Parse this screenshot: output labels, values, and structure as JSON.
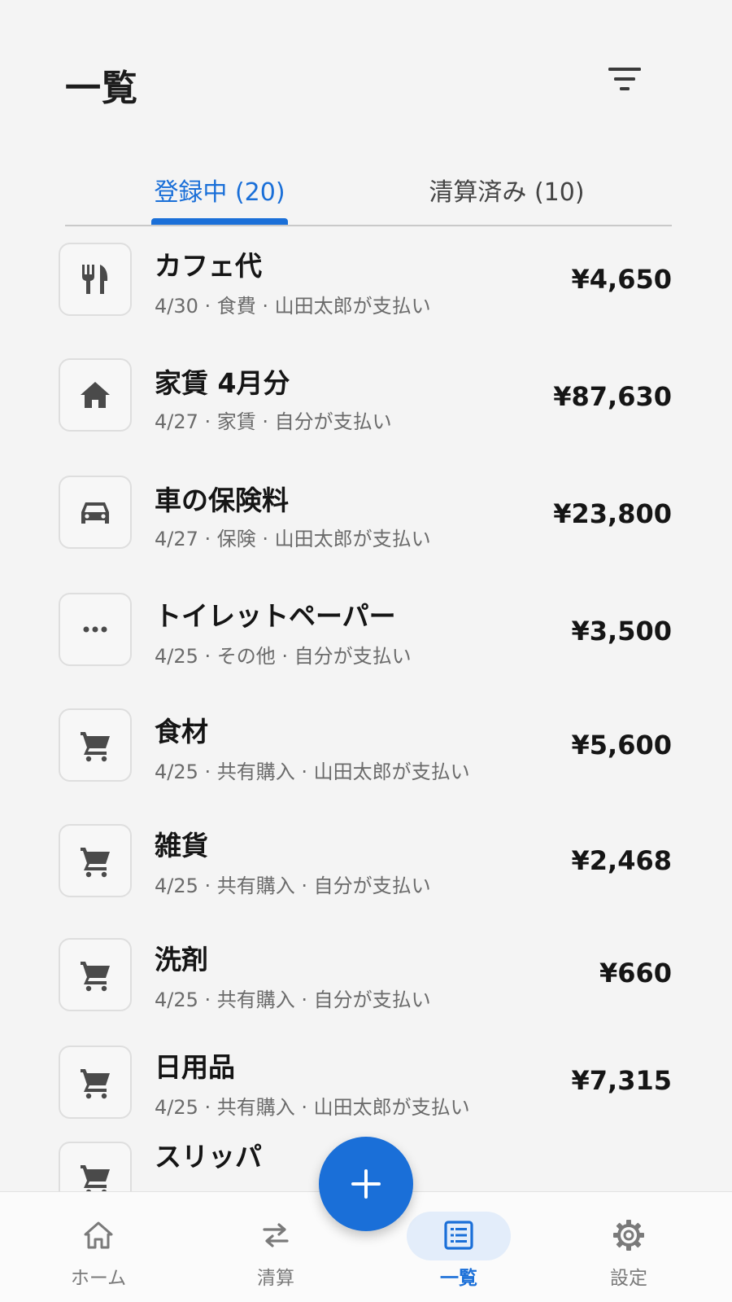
{
  "header": {
    "title": "一覧",
    "filter_icon": "filter-icon"
  },
  "tabs": [
    {
      "label": "登録中 (20)",
      "active": true
    },
    {
      "label": "清算済み (10)",
      "active": false
    }
  ],
  "expenses": [
    {
      "title": "カフェ代",
      "sub": "4/30 · 食費 · 山田太郎が支払い",
      "amount": "¥4,650",
      "icon": "cutlery-icon"
    },
    {
      "title": "家賃 4月分",
      "sub": "4/27 · 家賃 · 自分が支払い",
      "amount": "¥87,630",
      "icon": "home-icon"
    },
    {
      "title": "車の保険料",
      "sub": "4/27 · 保険 · 山田太郎が支払い",
      "amount": "¥23,800",
      "icon": "car-icon"
    },
    {
      "title": "トイレットペーパー",
      "sub": "4/25 · その他 · 自分が支払い",
      "amount": "¥3,500",
      "icon": "more-icon"
    },
    {
      "title": "食材",
      "sub": "4/25 · 共有購入 · 山田太郎が支払い",
      "amount": "¥5,600",
      "icon": "cart-icon"
    },
    {
      "title": "雑貨",
      "sub": "4/25 · 共有購入 · 自分が支払い",
      "amount": "¥2,468",
      "icon": "cart-icon"
    },
    {
      "title": "洗剤",
      "sub": "4/25 · 共有購入 · 自分が支払い",
      "amount": "¥660",
      "icon": "cart-icon"
    },
    {
      "title": "日用品",
      "sub": "4/25 · 共有購入 · 山田太郎が支払い",
      "amount": "¥7,315",
      "icon": "cart-icon"
    },
    {
      "title": "スリッパ",
      "sub": "",
      "amount": "",
      "icon": "cart-icon"
    }
  ],
  "fab": {
    "icon": "plus-icon"
  },
  "bottom_nav": [
    {
      "label": "ホーム",
      "icon": "home-outline-icon",
      "active": false
    },
    {
      "label": "清算",
      "icon": "swap-icon",
      "active": false
    },
    {
      "label": "一覧",
      "icon": "list-icon",
      "active": true
    },
    {
      "label": "設定",
      "icon": "gear-icon",
      "active": false
    }
  ],
  "colors": {
    "accent": "#1a6fd8",
    "background": "#f4f4f4",
    "nav_active_bg": "#e3edfa"
  }
}
